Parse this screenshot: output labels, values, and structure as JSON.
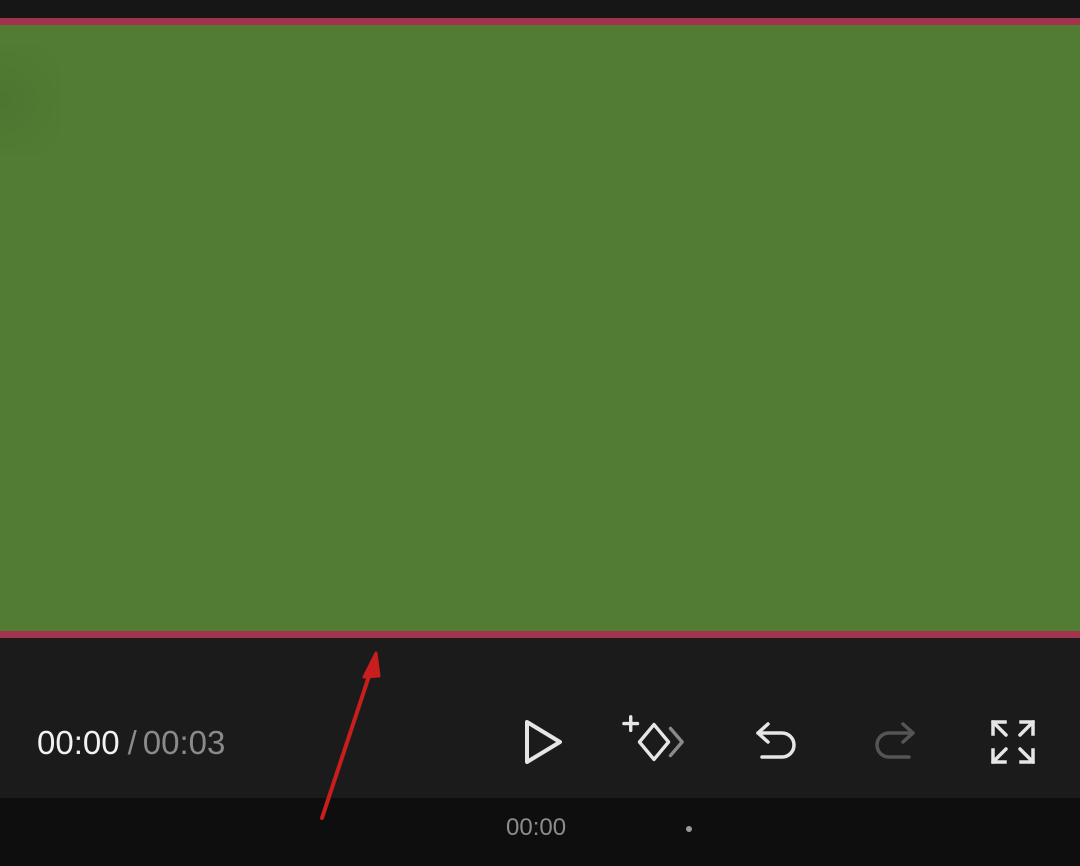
{
  "player": {
    "current_time": "00:00",
    "separator": "/",
    "total_time": "00:03"
  },
  "controls": {
    "play_icon": "play-icon",
    "add_keyframe_icon": "add-keyframe-icon",
    "undo_icon": "undo-icon",
    "redo_icon": "redo-icon",
    "fullscreen_icon": "fullscreen-icon"
  },
  "timeline": {
    "ruler_time": "00:00"
  },
  "colors": {
    "preview_fill": "#527C33",
    "selection_border": "#A3344E",
    "annotation_arrow": "#C81E1E",
    "control_bar": "#1B1B1B"
  }
}
